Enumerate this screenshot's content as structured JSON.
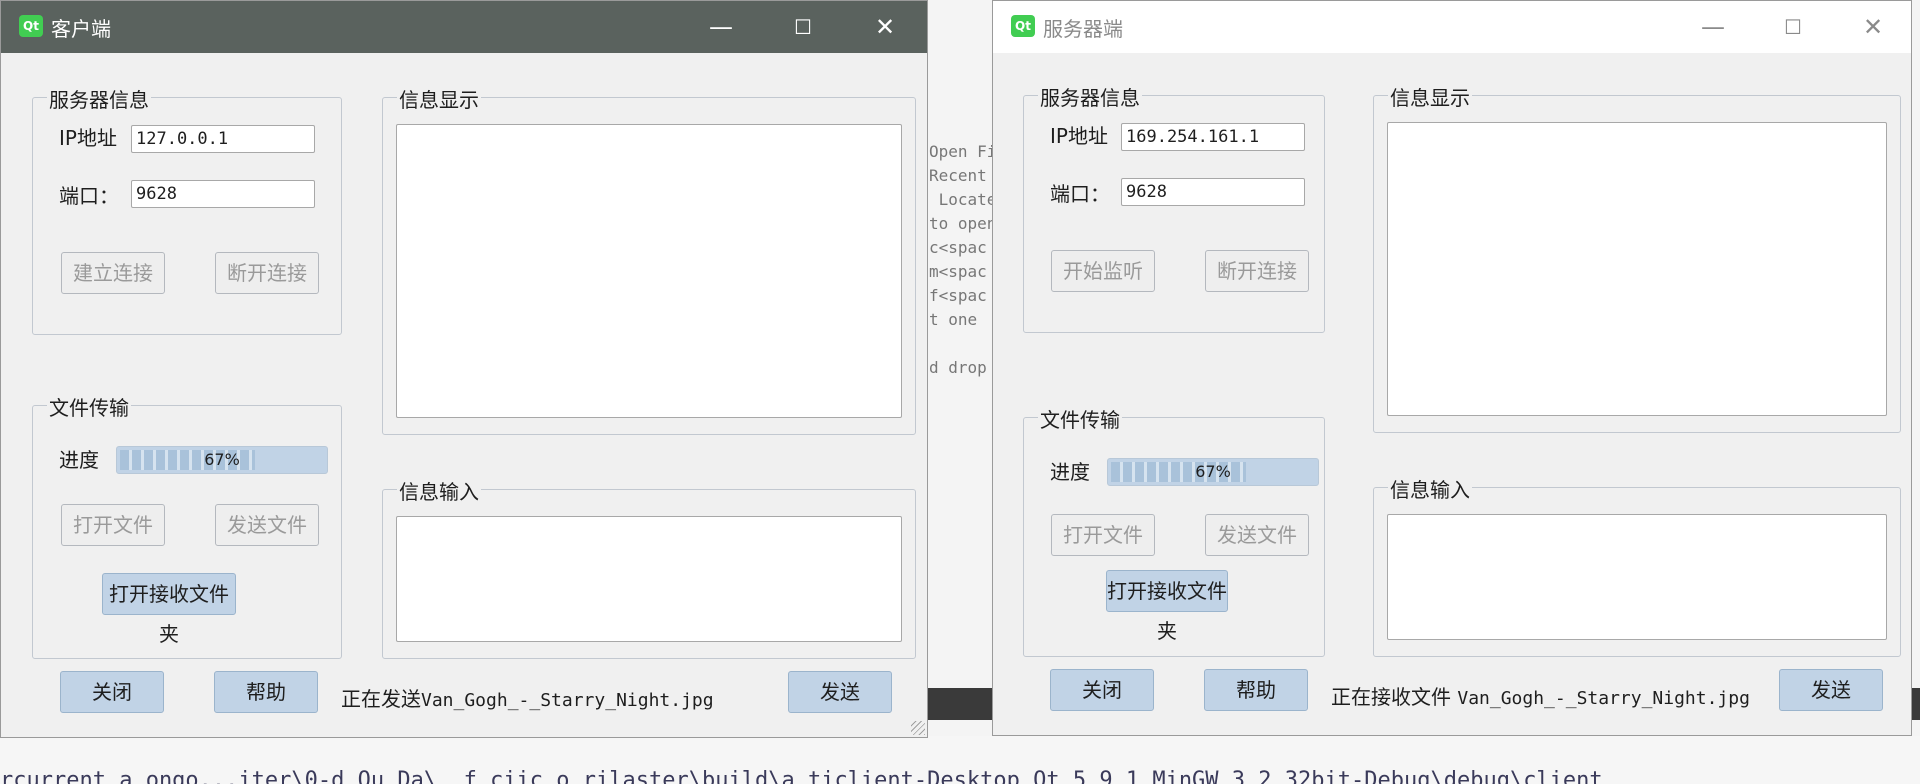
{
  "background": {
    "code_lines": [
      "Open Fi",
      "Recent",
      " Locate",
      "to open",
      "c<spac",
      "m<spac",
      "f<spac",
      "t one",
      "",
      "d drop"
    ],
    "bottom_strip": "rcurrent_a ongo...iter\\0-d_Qu_Da\\ _f_ciic_o_rilaster\\build\\a_ticlient-Desktop_Qt_5_9_1_MinGW_3_2_32bit-Debug\\debug\\client"
  },
  "client": {
    "app_icon": "qt-logo-icon",
    "title": "客户端",
    "controls": {
      "minimize": "—",
      "maximize": "☐",
      "close": "✕"
    },
    "server_group": {
      "legend": "服务器信息",
      "ip_label": "IP地址",
      "ip_value": "127.0.0.1",
      "port_label": "端口：",
      "port_value": "9628",
      "connect_btn": "建立连接",
      "disconnect_btn": "断开连接"
    },
    "display_group": {
      "legend": "信息显示"
    },
    "file_group": {
      "legend": "文件传输",
      "progress_label": "进度",
      "progress_text": "67%",
      "progress_value": 0.67,
      "open_file_btn": "打开文件",
      "send_file_btn": "发送文件",
      "open_folder_btn": "打开接收文件夹"
    },
    "input_group": {
      "legend": "信息输入"
    },
    "close_btn": "关闭",
    "help_btn": "帮助",
    "status_prefix": "正在发送",
    "status_file": "Van_Gogh_-_Starry_Night.jpg",
    "send_btn": "发送"
  },
  "server": {
    "app_icon": "qt-logo-icon",
    "title": "服务器端",
    "controls": {
      "minimize": "—",
      "maximize": "☐",
      "close": "✕"
    },
    "server_group": {
      "legend": "服务器信息",
      "ip_label": "IP地址",
      "ip_value": "169.254.161.1",
      "port_label": "端口：",
      "port_value": "9628",
      "listen_btn": "开始监听",
      "disconnect_btn": "断开连接"
    },
    "display_group": {
      "legend": "信息显示"
    },
    "file_group": {
      "legend": "文件传输",
      "progress_label": "进度",
      "progress_text": "67%",
      "progress_value": 0.67,
      "open_file_btn": "打开文件",
      "send_file_btn": "发送文件",
      "open_folder_btn": "打开接收文件夹"
    },
    "input_group": {
      "legend": "信息输入"
    },
    "close_btn": "关闭",
    "help_btn": "帮助",
    "status_prefix": "正在接收文件 ",
    "status_file": "Van_Gogh_-_Starry_Night.jpg",
    "send_btn": "发送"
  }
}
